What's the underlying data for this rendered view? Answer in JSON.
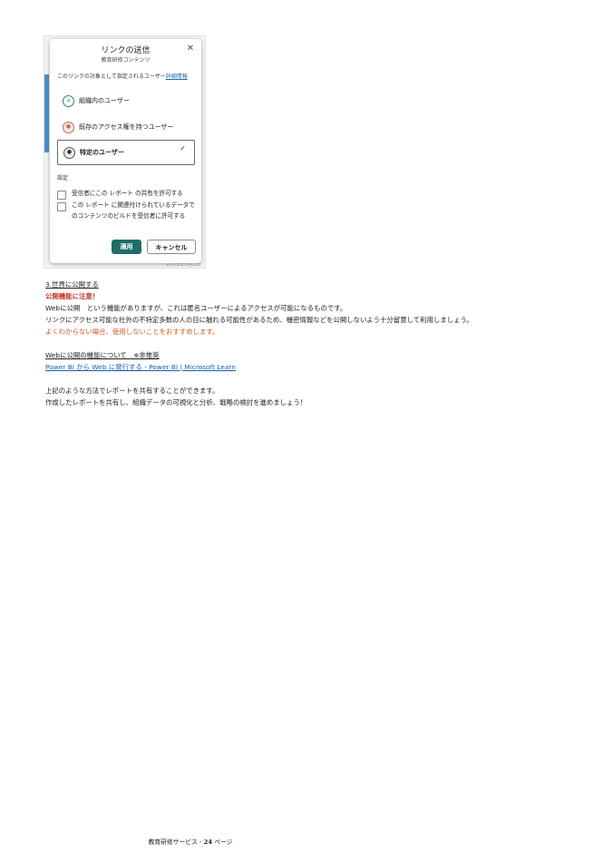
{
  "screenshot": {
    "date_stamp": "2023年5月1日",
    "dialog": {
      "title": "リンクの送信",
      "subtitle": "教育研修コンテンツ",
      "close_icon": "close-icon",
      "description": "このリンクの対象として指定されるユーザー",
      "description_link": "詳細情報",
      "options": [
        {
          "label": "組織内のユーザー",
          "icon": "building-icon",
          "selected": false
        },
        {
          "label": "既存のアクセス権を持つユーザー",
          "icon": "people-icon",
          "selected": false
        },
        {
          "label": "特定のユーザー",
          "icon": "person-icon",
          "selected": true
        }
      ],
      "settings_label": "設定",
      "checkboxes": [
        {
          "label": "受信者にこの レポート の共有を許可する",
          "checked": false
        },
        {
          "label": "この レポート に関連付けられているデータでのコンテンツのビルドを受信者に許可する",
          "checked": false
        }
      ],
      "apply_label": "適用",
      "cancel_label": "キャンセル",
      "accent_color": "#1f6e6a"
    }
  },
  "doc": {
    "section_heading": "3.世界に公開する",
    "warning_heading": "公開機能に注意！",
    "para1": "Webに公開　という機能がありますが、これは匿名ユーザーによるアクセスが可能になるものです。",
    "para2": "リンクにアクセス可能な社外の不特定多数の人の目に触れる可能性があるため、機密情報などを公開しないよう十分留意して利用しましょう。",
    "para3": "よくわからない場合、使用しないことをおすすめします。",
    "ref_heading": "Webに公開の機能について　※非推奨",
    "ref_link": "Power BI から Web に発行する - Power BI | Microsoft Learn",
    "closing1": "上記のような方法でレポートを共有することができます。",
    "closing2": "作成したレポートを共有し、組織データの可視化と分析、戦略の検討を進めましょう！"
  },
  "footer": {
    "prefix": "教育研修サービス - ",
    "page_number": "24",
    "suffix": " ページ"
  }
}
